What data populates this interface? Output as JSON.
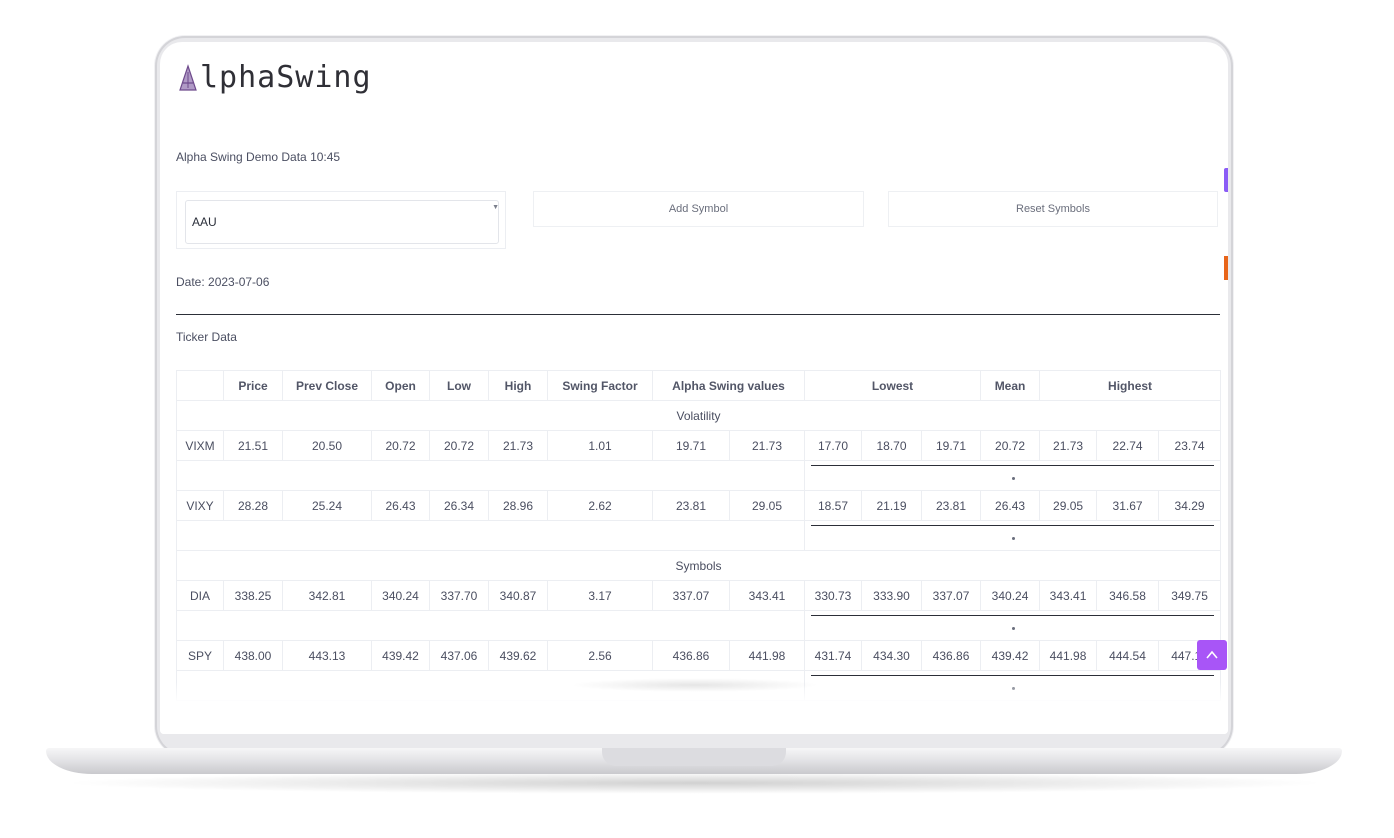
{
  "app": {
    "brand_initial": "A",
    "brand_rest": "lphaSwing"
  },
  "header": {
    "subtitle": "Alpha Swing Demo Data 10:45"
  },
  "controls": {
    "symbol_select_value": "AAU",
    "add_symbol_label": "Add Symbol",
    "reset_symbols_label": "Reset Symbols"
  },
  "date_line": "Date: 2023-07-06",
  "section_title": "Ticker Data",
  "table": {
    "headers": {
      "blank": "",
      "price": "Price",
      "prev_close": "Prev Close",
      "open": "Open",
      "low": "Low",
      "high": "High",
      "swing_factor": "Swing Factor",
      "alpha_swing_values": "Alpha Swing values",
      "lowest": "Lowest",
      "mean": "Mean",
      "highest": "Highest"
    },
    "groups": {
      "volatility": "Volatility",
      "symbols": "Symbols"
    },
    "rows": [
      {
        "symbol": "VIXM",
        "price": "21.51",
        "prev_close": "20.50",
        "open": "20.72",
        "low": "20.72",
        "high": "21.73",
        "swing": "1.01",
        "as1": "19.71",
        "as2": "21.73",
        "l1": "17.70",
        "l2": "18.70",
        "l3": "19.71",
        "mean": "20.72",
        "h1": "21.73",
        "h2": "22.74",
        "h3": "23.74"
      },
      {
        "symbol": "VIXY",
        "price": "28.28",
        "prev_close": "25.24",
        "open": "26.43",
        "low": "26.34",
        "high": "28.96",
        "swing": "2.62",
        "as1": "23.81",
        "as2": "29.05",
        "l1": "18.57",
        "l2": "21.19",
        "l3": "23.81",
        "mean": "26.43",
        "h1": "29.05",
        "h2": "31.67",
        "h3": "34.29"
      },
      {
        "symbol": "DIA",
        "price": "338.25",
        "prev_close": "342.81",
        "open": "340.24",
        "low": "337.70",
        "high": "340.87",
        "swing": "3.17",
        "as1": "337.07",
        "as2": "343.41",
        "l1": "330.73",
        "l2": "333.90",
        "l3": "337.07",
        "mean": "340.24",
        "h1": "343.41",
        "h2": "346.58",
        "h3": "349.75"
      },
      {
        "symbol": "SPY",
        "price": "438.00",
        "prev_close": "443.13",
        "open": "439.42",
        "low": "437.06",
        "high": "439.62",
        "swing": "2.56",
        "as1": "436.86",
        "as2": "441.98",
        "l1": "431.74",
        "l2": "434.30",
        "l3": "436.86",
        "mean": "439.42",
        "h1": "441.98",
        "h2": "444.54",
        "h3": "447.10"
      }
    ]
  },
  "colors": {
    "accent": "#a855f7",
    "side_tab_purple": "#8b5cf6",
    "side_tab_orange": "#e8651a",
    "logo_mark": "#7c4f9a"
  },
  "icons": {
    "logo": "alpha-swing-logo-mark",
    "select_caret": "chevron-down-icon",
    "scroll_top": "chevron-up-icon"
  }
}
